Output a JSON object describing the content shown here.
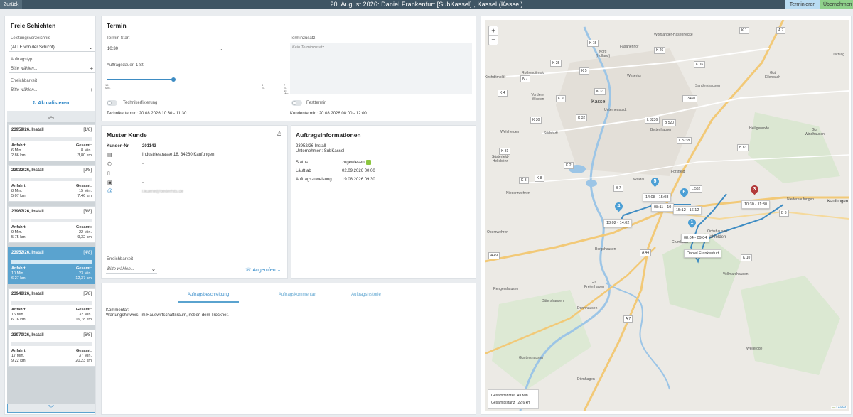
{
  "topbar": {
    "back": "Zurück",
    "title": "20. August 2026: Daniel Frankenfurt [SubKassel] , Kassel (Kassel)",
    "terminieren": "Terminieren",
    "uebernehmen": "Übernehmen"
  },
  "sidebar": {
    "title": "Freie Schichten",
    "leistung_label": "Leistungsverzeichnis",
    "leistung_value": "(ALLE von der Schicht)",
    "auftragstyp_label": "Auftragstyp",
    "auftragstyp_value": "Bitte wählen...",
    "erreichbarkeit_label": "Erreichbarkeit",
    "erreichbarkeit_value": "Bitte wählen...",
    "refresh": "Aktualisieren",
    "anfahrt_label": "Anfahrt:",
    "gesamt_label": "Gesamt:",
    "items": [
      {
        "title": "23959/26, Install",
        "count": "[1/8]",
        "a_min": "6 Min.",
        "a_km": "2,86 km",
        "g_min": "8 Min.",
        "g_km": "3,80 km"
      },
      {
        "title": "23932/26, Install",
        "count": "[2/8]",
        "a_min": "8 Min.",
        "a_km": "5,07 km",
        "g_min": "15 Min.",
        "g_km": "7,46 km"
      },
      {
        "title": "23967/26, Install",
        "count": "[3/8]",
        "a_min": "9 Min.",
        "a_km": "5,75 km",
        "g_min": "22 Min.",
        "g_km": "9,32 km"
      },
      {
        "title": "23952/26, Install",
        "count": "[4/8]",
        "a_min": "10 Min.",
        "a_km": "6,27 km",
        "g_min": "23 Min.",
        "g_km": "12,37 km"
      },
      {
        "title": "23948/26, Install",
        "count": "[5/8]",
        "a_min": "16 Min.",
        "a_km": "6,16 km",
        "g_min": "32 Min.",
        "g_km": "16,78 km"
      },
      {
        "title": "23970/26, Install",
        "count": "[6/8]",
        "a_min": "17 Min.",
        "a_km": "9,22 km",
        "g_min": "37 Min.",
        "g_km": "20,23 km"
      }
    ]
  },
  "termin": {
    "title": "Termin",
    "start_label": "Termin Start",
    "start_value": "10:30",
    "dauer_label": "Auftragsdauer: 1 St.",
    "tick_15": "15",
    "tick_min": "Min.",
    "tick_3": "3",
    "tick_st": "St.",
    "tick_7": "7",
    "tick_7b": "St.",
    "tick_15b": "15",
    "tick_minb": "Min.",
    "zusatz_label": "Terminzusatz",
    "zusatz_placeholder": "Kein Terminzusatz",
    "fix_label": "Technikerfixierung",
    "fest_label": "Festtermin",
    "techniker_termin": "Technikertermin: 20.08.2026 10:30 - 11:30",
    "kunden_termin": "Kundentermin: 20.08.2026 08:00 - 12:00"
  },
  "kunde": {
    "title": "Muster Kunde",
    "nr_label": "Kunden-Nr.",
    "nr_value": "201143",
    "address": "Industriestrasse 18, 34260 Kaufungen",
    "phone": "-",
    "mobile": "-",
    "fax": "-",
    "email": "l.kuene@beiterhits.de",
    "erreichbarkeit_label": "Erreichbarkeit",
    "erreichbarkeit_value": "Bitte wählen...",
    "angerufen": "Angerufen"
  },
  "auftrag": {
    "title": "Auftragsinformationen",
    "line1": "23952/26 Install",
    "line2": "Unternehmen: SubKassel",
    "status_label": "Status",
    "status_value": "zugewiesen",
    "status_color": "#8cc63f",
    "laeuft_label": "Läuft ab",
    "laeuft_value": "02.09.2026 00:00",
    "zuweisung_label": "Auftragszuweisung",
    "zuweisung_value": "19.08.2026 09:30"
  },
  "tabs": {
    "beschreibung": "Auftragsbeschreibung",
    "kommentar": "Auftragskommentar",
    "historie": "Auftragshistorie"
  },
  "kommentar": {
    "label": "Kommentar:",
    "text": "Wartungshinweis: Im Hauswirtschaftsraum, neben dem Trockner."
  },
  "map": {
    "zoom_in": "+",
    "zoom_out": "−",
    "places": [
      "Wolfsanger-Hasenhecke",
      "Fasanenhof",
      "Nord (Holland)",
      "Rothenditmold",
      "Kirchditmold",
      "Wesertor",
      "Vorderer Westen",
      "Kassel",
      "Unterneustadt",
      "Sandershausen",
      "Gut Ellenbach",
      "Bettenhausen",
      "Heiligenrode",
      "Gut Windhausen",
      "Wehlheiden",
      "Südstadt",
      "Forstfeld",
      "Süsterfeld-Helleböhn",
      "Niederzwehren",
      "Waldau",
      "Niederkaufungen",
      "Kaufungen",
      "Oberzwehren",
      "Lohfelden",
      "Bergshausen",
      "Gut Freienhagen",
      "Vollmarshausen",
      "Rengershausen",
      "Crumbach",
      "Ochshausen",
      "Dennhausen",
      "Dittershausen",
      "Wellerode",
      "Guntershausen",
      "Dörnhagen",
      "Uschlag"
    ],
    "roads": [
      "A 7",
      "K 15",
      "K 26",
      "K 16",
      "K 25",
      "K 7",
      "K 5",
      "K 4",
      "K 9",
      "K 33",
      "K 32",
      "K 30",
      "K 31",
      "K 3",
      "K 8",
      "K 2",
      "B 3",
      "B 7",
      "A 49",
      "A 44",
      "B 83",
      "L 3236",
      "L 562",
      "L 3460",
      "B 520",
      "A 7",
      "K 10",
      "K 1",
      "L 3238"
    ],
    "time_labels": [
      "14:08 - 15:08",
      "08:11 - 10",
      "15:12 - 16:12",
      "13:02 - 14:02",
      "08:04 - 09:04",
      "10:30 - 11:30"
    ],
    "pins": [
      "5",
      "6",
      "4",
      "1",
      "3"
    ],
    "driver_label": "Daniel Frankenfurt",
    "info_fahrzeit_label": "Gesamtfahrzeit",
    "info_fahrzeit_value": "49 Min.",
    "info_distanz_label": "Gesamtdistanz",
    "info_distanz_value": "22,6 km",
    "attribution": "Leaflet"
  },
  "colors": {
    "accent": "#5aa3cf",
    "topbar": "#3f5564",
    "terminieren": "#b9dcf2",
    "uebernehmen": "#8fd18b",
    "water": "#9cc5e6",
    "road": "#f2c977",
    "route": "#3e8cc3",
    "pin_red": "#b23a3a"
  }
}
